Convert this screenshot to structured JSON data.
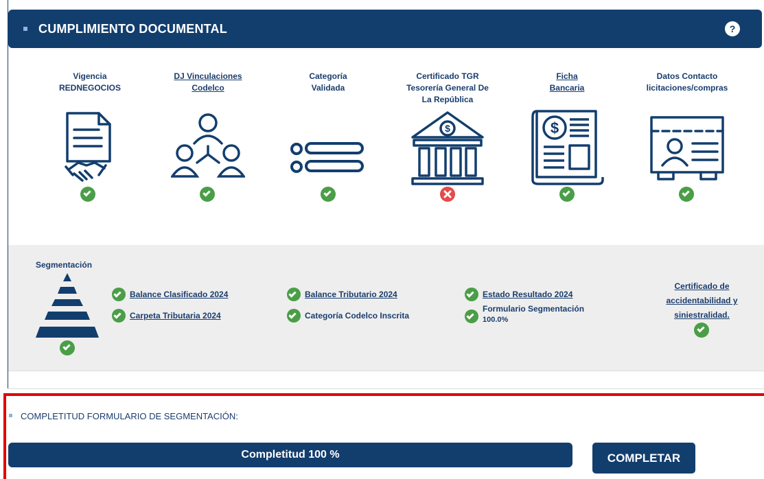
{
  "header": {
    "title": "CUMPLIMIENTO DOCUMENTAL",
    "help_label": "?"
  },
  "documents": [
    {
      "line1": "Vigencia",
      "line2": "REDNEGOCIOS",
      "line3": "",
      "link": false,
      "status": "ok",
      "icon": "contract-handshake-icon"
    },
    {
      "line1": "DJ Vinculaciones",
      "line2": "Codelco",
      "line3": "",
      "link": true,
      "status": "ok",
      "icon": "people-network-icon"
    },
    {
      "line1": "Categoría",
      "line2": "Validada",
      "line3": "",
      "link": false,
      "status": "ok",
      "icon": "category-list-icon"
    },
    {
      "line1": "Certificado TGR",
      "line2": "Tesorería General De",
      "line3": "La República",
      "link": false,
      "status": "error",
      "icon": "bank-building-icon"
    },
    {
      "line1": "Ficha",
      "line2": "Bancaria",
      "line3": "",
      "link": true,
      "status": "ok",
      "icon": "bank-document-icon"
    },
    {
      "line1": "Datos Contacto",
      "line2": "licitaciones/compras",
      "line3": "",
      "link": false,
      "status": "ok",
      "icon": "contact-card-icon"
    }
  ],
  "segmentation": {
    "title": "Segmentación",
    "items": [
      {
        "label": "Balance Clasificado 2024",
        "link": true
      },
      {
        "label": "Carpeta Tributaria 2024",
        "link": true
      },
      {
        "label": "Balance Tributario 2024",
        "link": true
      },
      {
        "label": "Categoría Codelco Inscrita",
        "link": false
      },
      {
        "label": "Estado Resultado 2024",
        "link": true
      },
      {
        "label": "Formulario Segmentación",
        "link": false,
        "sub": "100.0%"
      }
    ],
    "certificate": {
      "line1": "Certificado de",
      "line2": "accidentabilidad y",
      "line3": "siniestralidad."
    }
  },
  "completion": {
    "title": "COMPLETITUD FORMULARIO DE SEGMENTACIÓN:",
    "bar_label": "Completitud 100 %",
    "progress": 1.0,
    "button_label": "COMPLETAR"
  },
  "colors": {
    "navy": "#123e6e",
    "ok": "#4a9e47",
    "error": "#e54b4b",
    "highlight": "#e00000"
  }
}
